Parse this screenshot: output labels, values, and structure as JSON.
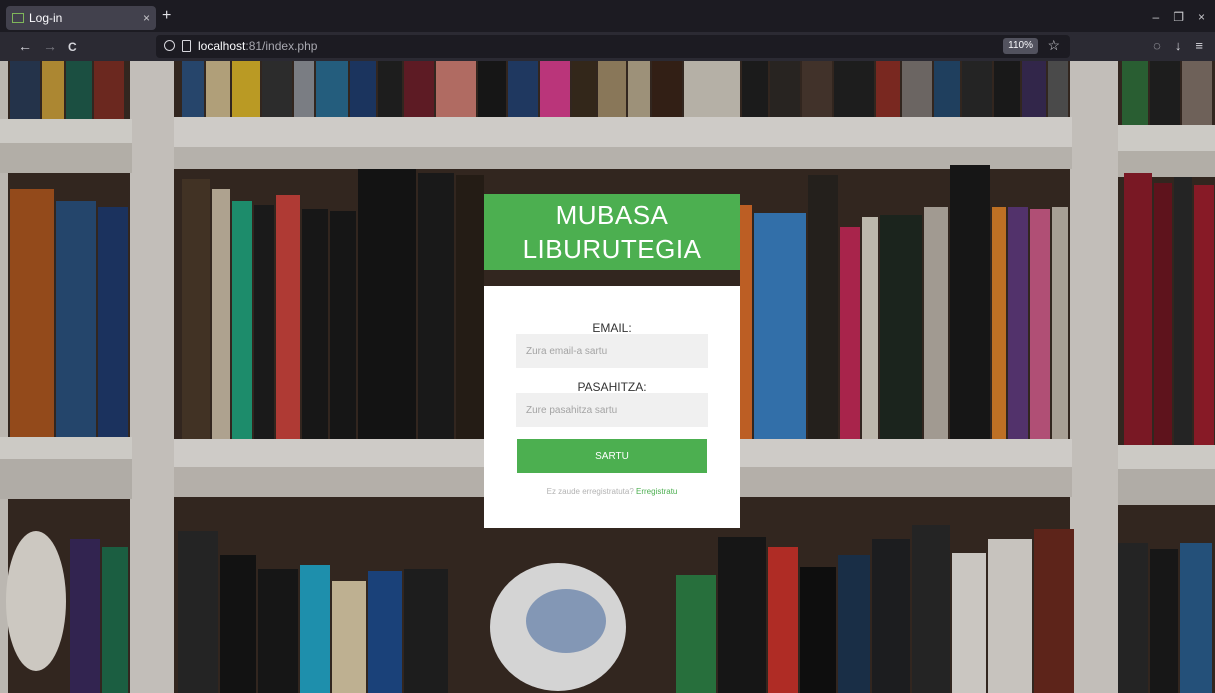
{
  "browser": {
    "tab_title": "Log-in",
    "tab_close": "×",
    "new_tab": "+",
    "win_minimize": "–",
    "win_maximize": "❐",
    "win_close": "×",
    "back": "←",
    "forward": "→",
    "reload": "C",
    "url_host": "localhost",
    "url_rest": ":81/index.php",
    "zoom": "110%",
    "bookmark": "☆",
    "pocket": "◌",
    "download": "↓",
    "menu": "≡"
  },
  "login": {
    "title_line1": "MUBASA",
    "title_line2": "LIBURUTEGIA",
    "email_label": "EMAIL:",
    "email_placeholder": "Zura email-a sartu",
    "password_label": "PASAHITZA:",
    "password_placeholder": "Zure pasahitza sartu",
    "submit_label": "SARTU",
    "register_prompt": "Ez zaude erregistratuta?",
    "register_link": "Erregistratu"
  },
  "colors": {
    "accent_green": "#4caf50",
    "browser_dark": "#1c1b22",
    "browser_toolbar": "#2b2a33"
  },
  "icons": [
    "favicon-icon",
    "shield-icon",
    "page-icon",
    "star-icon",
    "pocket-icon",
    "download-icon",
    "menu-icon"
  ]
}
